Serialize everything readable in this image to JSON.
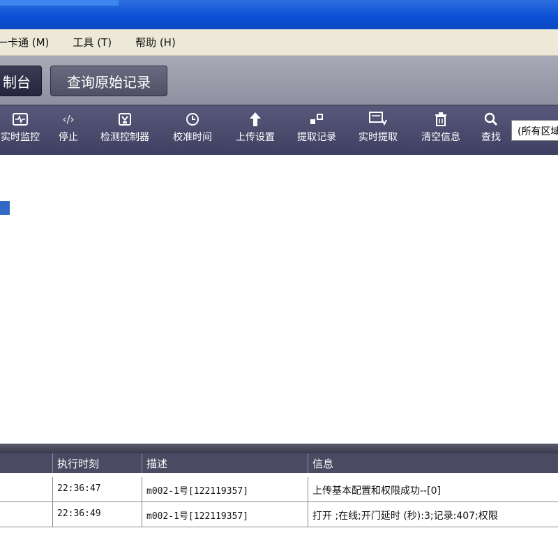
{
  "menu": {
    "items": [
      {
        "label": "一卡通 (M)"
      },
      {
        "label": "工具 (T)"
      },
      {
        "label": "帮助 (H)"
      }
    ]
  },
  "tabs": [
    {
      "label": "制台",
      "active": true
    },
    {
      "label": "查询原始记录",
      "active": false
    }
  ],
  "toolbar": {
    "buttons": [
      {
        "label": "实时监控",
        "icon": "monitor-wave-icon"
      },
      {
        "label": "停止",
        "icon": "stop-code-icon"
      },
      {
        "label": "检测控制器",
        "icon": "controller-check-icon"
      },
      {
        "label": "校准时间",
        "icon": "clock-icon"
      },
      {
        "label": "上传设置",
        "icon": "upload-arrow-icon"
      },
      {
        "label": "提取记录",
        "icon": "extract-records-icon"
      },
      {
        "label": "实时提取",
        "icon": "realtime-extract-icon"
      },
      {
        "label": "清空信息",
        "icon": "trash-icon"
      },
      {
        "label": "查找",
        "icon": "search-icon"
      }
    ],
    "area_select": "(所有区域)"
  },
  "log_grid": {
    "columns": [
      "",
      "执行时刻",
      "描述",
      "信息"
    ],
    "rows": [
      {
        "index": "",
        "time": "22:36:47",
        "desc": "m002-1号[122119357]",
        "info": "上传基本配置和权限成功--[0]"
      },
      {
        "index": "",
        "time": "22:36:49",
        "desc": "m002-1号[122119357]",
        "info": "打开 ;在线;开门延时 (秒):3;记录:407;权限"
      }
    ]
  },
  "colors": {
    "titlebar": "#0a4fd3",
    "menubar": "#ece9d8",
    "toolbar": "#4a4a6c",
    "grid_header": "#4a4a62",
    "selection": "#316ac5"
  }
}
